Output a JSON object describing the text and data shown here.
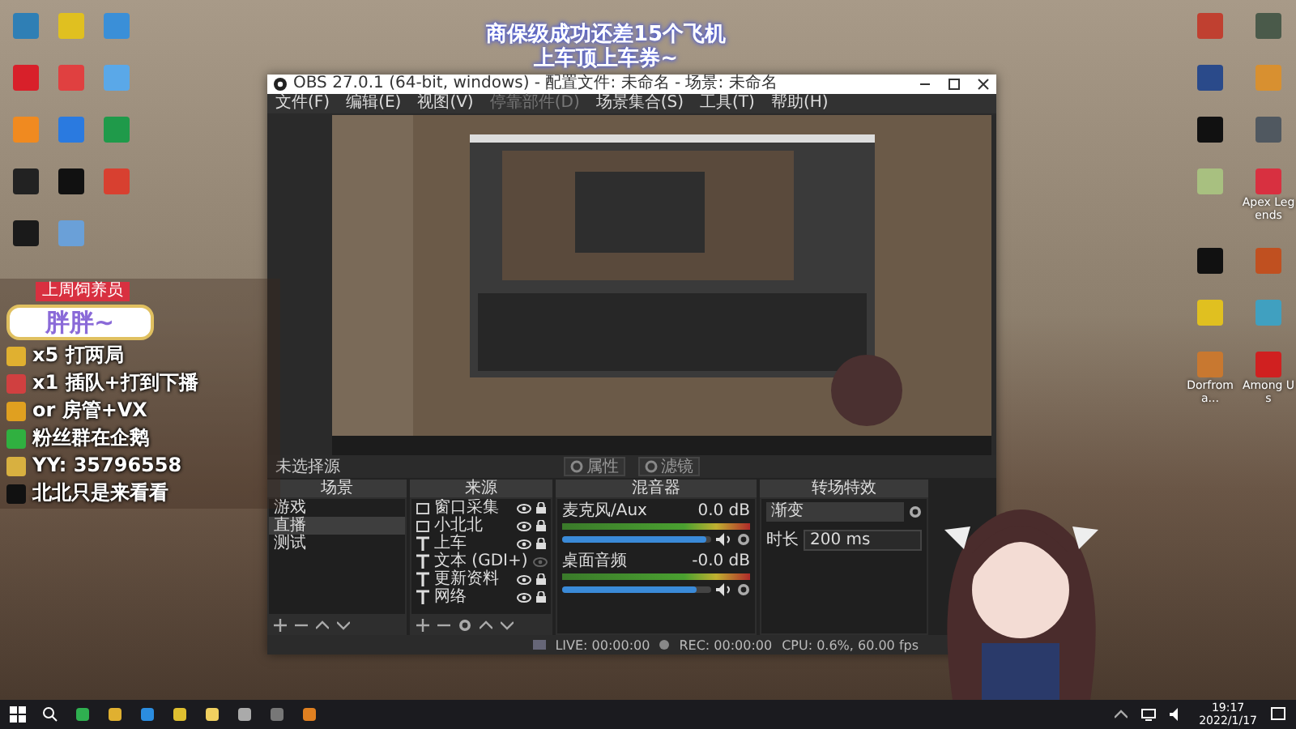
{
  "caption": [
    "商保级成功还差15个飞机",
    "上车顶上车券~"
  ],
  "desktop_icons_left": [
    {
      "color": "#2f7fb5"
    },
    {
      "color": "#e0c020"
    },
    {
      "color": "#3a8fd8"
    },
    {
      "color": "#d8202a"
    },
    {
      "color": "#e04040"
    },
    {
      "color": "#5aa8e8"
    },
    {
      "color": "#f08a20"
    },
    {
      "color": "#2a7ae0"
    },
    {
      "color": "#1f9a4a"
    },
    {
      "color": "#222222"
    },
    {
      "color": "#111111"
    },
    {
      "color": "#d84030"
    },
    {
      "color": "#1a1a1a"
    },
    {
      "color": "#6aa0d8"
    }
  ],
  "desktop_icons_right": [
    {
      "color": "#c04030"
    },
    {
      "color": "#4a5a4a"
    },
    {
      "color": "#2a4a8a"
    },
    {
      "color": "#d89030"
    },
    {
      "color": "#111111"
    },
    {
      "color": "#505860"
    },
    {
      "color": "#a8c080"
    },
    {
      "color": "#d83040",
      "label": "Apex Legends"
    },
    {
      "color": "#111111"
    },
    {
      "color": "#c05020"
    },
    {
      "color": "#e0c020"
    },
    {
      "color": "#40a0c0"
    },
    {
      "color": "#c87830",
      "label": "Dorfroma..."
    },
    {
      "color": "#d02020",
      "label": "Among Us"
    }
  ],
  "obs": {
    "title": "OBS 27.0.1 (64-bit, windows) - 配置文件: 未命名 - 场景: 未命名",
    "menu": [
      {
        "label": "文件(F)",
        "disabled": false
      },
      {
        "label": "编辑(E)",
        "disabled": false
      },
      {
        "label": "视图(V)",
        "disabled": false
      },
      {
        "label": "停靠部件(D)",
        "disabled": true
      },
      {
        "label": "场景集合(S)",
        "disabled": false
      },
      {
        "label": "工具(T)",
        "disabled": false
      },
      {
        "label": "帮助(H)",
        "disabled": false
      }
    ],
    "toolbar": {
      "status": "未选择源",
      "buttons": [
        "属性",
        "滤镜"
      ]
    },
    "scenes": {
      "title": "场景",
      "items": [
        {
          "label": "游戏",
          "selected": false
        },
        {
          "label": "直播",
          "selected": true
        },
        {
          "label": "测试",
          "selected": false
        }
      ]
    },
    "sources": {
      "title": "来源",
      "items": [
        {
          "label": "窗口采集",
          "kind": "window",
          "visible": true
        },
        {
          "label": "小北北",
          "kind": "window",
          "visible": true
        },
        {
          "label": "上车",
          "kind": "text",
          "visible": true
        },
        {
          "label": "文本 (GDI+)",
          "kind": "text",
          "visible": false
        },
        {
          "label": "更新资料",
          "kind": "text",
          "visible": true
        },
        {
          "label": "网络",
          "kind": "text",
          "visible": true
        }
      ]
    },
    "mixer": {
      "title": "混音器",
      "channels": [
        {
          "name": "麦克风/Aux",
          "reading": "0.0 dB",
          "level": 0.97
        },
        {
          "name": "桌面音频",
          "reading": "-0.0 dB",
          "level": 0.9
        }
      ]
    },
    "transitions": {
      "title": "转场特效",
      "type": "渐变",
      "duration_label": "时长",
      "duration": "200 ms"
    },
    "status_bar": {
      "live": "LIVE: 00:00:00",
      "rec": "REC: 00:00:00",
      "cpu": "CPU: 0.6%, 60.00 fps"
    }
  },
  "stream_overlay": {
    "badge": "上周饲养员",
    "name": "胖胖~",
    "lines": [
      {
        "text": "x5 打两局",
        "color": "#e0b030"
      },
      {
        "text": "x1 插队+打到下播",
        "color": "#d04040"
      },
      {
        "text": "or 房管+VX",
        "color": "#e0a020"
      },
      {
        "text": "粉丝群在企鹅",
        "color": "#30b040"
      },
      {
        "text": "YY: 35796558",
        "color": "#d8b040"
      },
      {
        "text": "北北只是来看看",
        "color": "#111111"
      }
    ]
  },
  "taskbar": {
    "time": "19:17",
    "date": "2022/1/17"
  }
}
